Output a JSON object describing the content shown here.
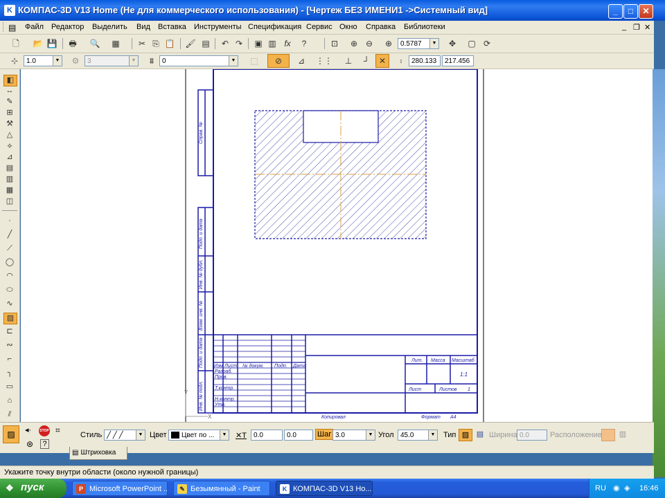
{
  "window": {
    "title": "КОМПАС-3D V13 Home (Не для коммерческого использования) - [Чертеж БЕЗ ИМЕНИ1 ->Системный вид]",
    "app_icon": "K",
    "minimize": "_",
    "maximize": "□",
    "close": "✕"
  },
  "menu": {
    "items": [
      "Файл",
      "Редактор",
      "Выделить",
      "Вид",
      "Вставка",
      "Инструменты",
      "Спецификация",
      "Сервис",
      "Окно",
      "Справка",
      "Библиотеки"
    ],
    "mdi_min": "_",
    "mdi_restore": "❐",
    "mdi_close": "✕"
  },
  "toolbar1": {
    "zoom_value": "0.5787"
  },
  "toolbar2": {
    "scale_value": "1.0",
    "layer_value": "3",
    "style_value": "0",
    "coord_x": "280.133",
    "coord_y": "217.456"
  },
  "drawing": {
    "stamp_top_label": "Справ. №",
    "side_labels": [
      "Подп. и дата",
      "Инв. № дубл.",
      "Взам. инв. №",
      "Подп. и дата",
      "Инв. № подл."
    ],
    "stamp_headers": [
      "Изм",
      "Лист",
      "№ докум.",
      "Подп.",
      "Дата"
    ],
    "stamp_roles": [
      "Разраб.",
      "Пров.",
      "Т.контр.",
      "Н.контр.",
      "Утв."
    ],
    "stamp_right_headers": [
      "Лит.",
      "Масса",
      "Масштаб"
    ],
    "scale": "1:1",
    "sheet_label": "Лист",
    "sheets_label": "Листов",
    "sheets_value": "1",
    "copied_label": "Копировал",
    "format_label": "Формат",
    "format_value": "A4",
    "axis_y": "Y",
    "axis_x": "X"
  },
  "properties": {
    "style_label": "Стиль",
    "color_label": "Цвет",
    "color_value": "Цвет по ...",
    "t_label": "Т",
    "t_x": "0.0",
    "t_y": "0.0",
    "step_label": "Шаг",
    "step_value": "3.0",
    "angle_label": "Угол",
    "angle_value": "45.0",
    "type_label": "Тип",
    "width_label": "Ширина",
    "width_value": "0.0",
    "layout_label": "Расположение",
    "tab_label": "Штриховка"
  },
  "status": {
    "message": "Укажите точку внутри области (около нужной границы)"
  },
  "taskbar": {
    "start_label": "пуск",
    "tasks": [
      {
        "label": "Microsoft PowerPoint ...",
        "icon": "P"
      },
      {
        "label": "Безымянный - Paint",
        "icon": "✎"
      },
      {
        "label": "КОМПАС-3D V13 Но...",
        "icon": "K"
      }
    ],
    "lang": "RU",
    "clock": "16:46"
  },
  "colors": {
    "frame_blue": "#1a1aa8",
    "hatch_blue": "#2020a0",
    "axis_orange": "#d8a040",
    "xp_blue": "#0b54d6"
  }
}
